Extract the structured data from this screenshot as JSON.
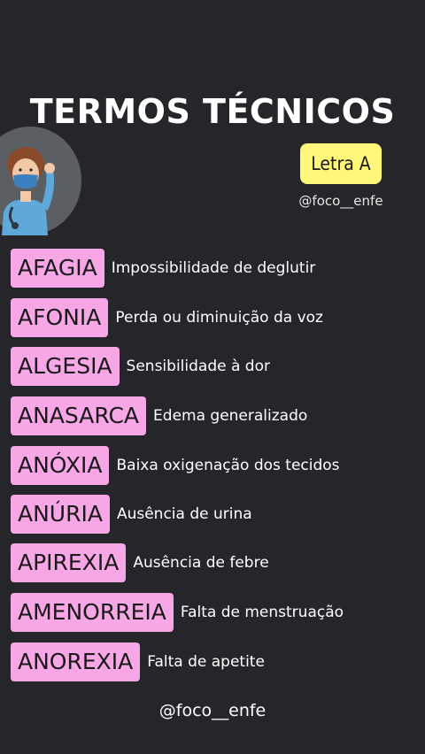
{
  "header": {
    "title": "TERMOS TÉCNICOS",
    "badge": "Letra A",
    "handle": "@foco__enfe"
  },
  "avatar": {
    "icon": "nurse-illustration-icon",
    "circle_color": "#5b5e63"
  },
  "terms": [
    {
      "term": "AFAGIA",
      "definition": "Impossibilidade de deglutir"
    },
    {
      "term": "AFONIA",
      "definition": "Perda ou diminuição da voz"
    },
    {
      "term": "ALGESIA",
      "definition": "Sensibilidade à dor"
    },
    {
      "term": "ANASARCA",
      "definition": "Edema generalizado"
    },
    {
      "term": "ANÓXIA",
      "definition": "Baixa oxigenação dos tecidos"
    },
    {
      "term": "ANÚRIA",
      "definition": "Ausência de urina"
    },
    {
      "term": "APIREXIA",
      "definition": "Ausência de febre"
    },
    {
      "term": "AMENORREIA",
      "definition": "Falta de menstruação"
    },
    {
      "term": "ANOREXIA",
      "definition": "Falta de apetite"
    }
  ],
  "footer": {
    "handle": "@foco__enfe"
  },
  "colors": {
    "background": "#26262a",
    "tag": "#f7a6e6",
    "badge": "#fff779"
  }
}
